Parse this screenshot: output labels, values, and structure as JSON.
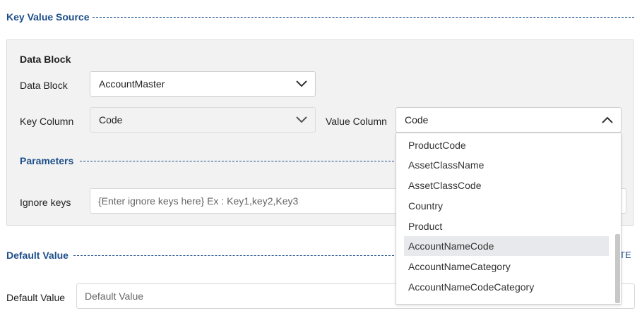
{
  "key_value_source": {
    "title": "Key Value Source"
  },
  "data_block_section": {
    "heading": "Data Block",
    "data_block_label": "Data Block",
    "data_block_value": "AccountMaster",
    "key_column_label": "Key Column",
    "key_column_value": "Code",
    "value_column_label": "Value Column",
    "value_column_value": "Code"
  },
  "parameters": {
    "title": "Parameters",
    "ignore_keys_label": "Ignore keys",
    "ignore_keys_placeholder": "{Enter ignore keys here} Ex : Key1,key2,Key3"
  },
  "default_value_section": {
    "title": "Default Value",
    "label": "Default Value",
    "placeholder": "Default Value",
    "partial_button_text": "TE"
  },
  "value_column_dropdown": {
    "options": [
      "ProductCode",
      "AssetClassName",
      "AssetClassCode",
      "Country",
      "Product",
      "AccountNameCode",
      "AccountNameCategory",
      "AccountNameCodeCategory"
    ],
    "highlighted_option": "AccountNameCode"
  },
  "colors": {
    "section_title": "#1d4e89",
    "panel_bg": "#f2f2f2",
    "highlight_bg": "#e7e9ec"
  },
  "icons": [
    "chevron-down-icon",
    "chevron-up-icon"
  ]
}
